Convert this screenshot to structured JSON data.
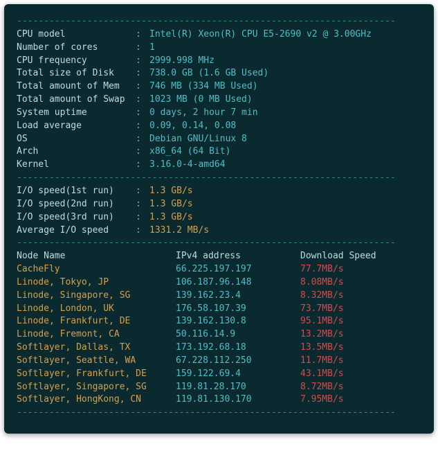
{
  "hr": "----------------------------------------------------------------------",
  "specs": [
    {
      "label": "CPU model",
      "value": "Intel(R) Xeon(R) CPU E5-2690 v2 @ 3.00GHz",
      "cls": "val-cyan"
    },
    {
      "label": "Number of cores",
      "value": "1",
      "cls": "val-cyan"
    },
    {
      "label": "CPU frequency",
      "value": "2999.998 MHz",
      "cls": "val-cyan"
    },
    {
      "label": "Total size of Disk",
      "value": "738.0 GB (1.6 GB Used)",
      "cls": "val-cyan"
    },
    {
      "label": "Total amount of Mem",
      "value": "746 MB (334 MB Used)",
      "cls": "val-cyan"
    },
    {
      "label": "Total amount of Swap",
      "value": "1023 MB (0 MB Used)",
      "cls": "val-cyan"
    },
    {
      "label": "System uptime",
      "value": "0 days, 2 hour 7 min",
      "cls": "val-cyan"
    },
    {
      "label": "Load average",
      "value": "0.09, 0.14, 0.08",
      "cls": "val-cyan"
    },
    {
      "label": "OS",
      "value": "Debian GNU/Linux 8",
      "cls": "val-cyan"
    },
    {
      "label": "Arch",
      "value": "x86_64 (64 Bit)",
      "cls": "val-cyan"
    },
    {
      "label": "Kernel",
      "value": "3.16.0-4-amd64",
      "cls": "val-cyan"
    }
  ],
  "io": [
    {
      "label": "I/O speed(1st run)",
      "value": "1.3 GB/s",
      "cls": "val-yellow"
    },
    {
      "label": "I/O speed(2nd run)",
      "value": "1.3 GB/s",
      "cls": "val-yellow"
    },
    {
      "label": "I/O speed(3rd run)",
      "value": "1.3 GB/s",
      "cls": "val-yellow"
    },
    {
      "label": "Average I/O speed",
      "value": "1331.2 MB/s",
      "cls": "val-yellow"
    }
  ],
  "headers": {
    "name": "Node Name",
    "ip": "IPv4 address",
    "speed": "Download Speed"
  },
  "nodes": [
    {
      "name": "CacheFly",
      "ip": "66.225.197.197",
      "speed": "77.7MB/s"
    },
    {
      "name": "Linode, Tokyo, JP",
      "ip": "106.187.96.148",
      "speed": "8.08MB/s"
    },
    {
      "name": "Linode, Singapore, SG",
      "ip": "139.162.23.4",
      "speed": "8.32MB/s"
    },
    {
      "name": "Linode, London, UK",
      "ip": "176.58.107.39",
      "speed": "73.7MB/s"
    },
    {
      "name": "Linode, Frankfurt, DE",
      "ip": "139.162.130.8",
      "speed": "95.1MB/s"
    },
    {
      "name": "Linode, Fremont, CA",
      "ip": "50.116.14.9",
      "speed": "13.2MB/s"
    },
    {
      "name": "Softlayer, Dallas, TX",
      "ip": "173.192.68.18",
      "speed": "13.5MB/s"
    },
    {
      "name": "Softlayer, Seattle, WA",
      "ip": "67.228.112.250",
      "speed": "11.7MB/s"
    },
    {
      "name": "Softlayer, Frankfurt, DE",
      "ip": "159.122.69.4",
      "speed": "43.1MB/s"
    },
    {
      "name": "Softlayer, Singapore, SG",
      "ip": "119.81.28.170",
      "speed": "8.72MB/s"
    },
    {
      "name": "Softlayer, HongKong, CN",
      "ip": "119.81.130.170",
      "speed": "7.95MB/s"
    }
  ]
}
